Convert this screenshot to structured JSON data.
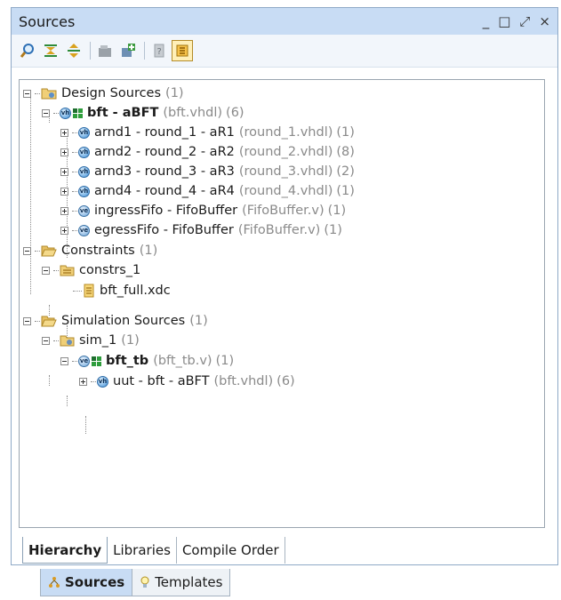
{
  "panel": {
    "title": "Sources",
    "window_controls": [
      "_",
      "□",
      "⤢",
      "×"
    ]
  },
  "toolbar": {
    "buttons": [
      {
        "icon": "search-icon"
      },
      {
        "icon": "collapse-all-icon"
      },
      {
        "icon": "expand-all-icon"
      },
      {
        "icon": "add-sources-icon"
      },
      {
        "icon": "add-module-icon"
      },
      {
        "icon": "properties-icon"
      },
      {
        "icon": "show-hierarchy-icon",
        "active": true
      }
    ]
  },
  "tree": {
    "design_sources": {
      "label": "Design Sources",
      "count": "(1)"
    },
    "bft": {
      "label": "bft - aBFT",
      "file": "(bft.vhdl)",
      "count": "(6)"
    },
    "arnd1": {
      "label": "arnd1 - round_1 - aR1",
      "file": "(round_1.vhdl)",
      "count": "(1)"
    },
    "arnd2": {
      "label": "arnd2 - round_2 - aR2",
      "file": "(round_2.vhdl)",
      "count": "(8)"
    },
    "arnd3": {
      "label": "arnd3 - round_3 - aR3",
      "file": "(round_3.vhdl)",
      "count": "(2)"
    },
    "arnd4": {
      "label": "arnd4 - round_4 - aR4",
      "file": "(round_4.vhdl)",
      "count": "(1)"
    },
    "ingress": {
      "label": "ingressFifo - FifoBuffer",
      "file": "(FifoBuffer.v)",
      "count": "(1)"
    },
    "egress": {
      "label": "egressFifo - FifoBuffer",
      "file": "(FifoBuffer.v)",
      "count": "(1)"
    },
    "constraints": {
      "label": "Constraints",
      "count": "(1)"
    },
    "constrs_1": {
      "label": "constrs_1"
    },
    "bft_full": {
      "label": "bft_full.xdc"
    },
    "sim_sources": {
      "label": "Simulation Sources",
      "count": "(1)"
    },
    "sim_1": {
      "label": "sim_1",
      "count": "(1)"
    },
    "bft_tb": {
      "label": "bft_tb",
      "file": "(bft_tb.v)",
      "count": "(1)"
    },
    "uut": {
      "label": "uut - bft - aBFT",
      "file": "(bft.vhdl)",
      "count": "(6)"
    }
  },
  "view_tabs": [
    "Hierarchy",
    "Libraries",
    "Compile Order"
  ],
  "bottom_tabs": [
    "Sources",
    "Templates"
  ],
  "colors": {
    "titlebar": "#c8dcf4",
    "muted": "#8a8a8a"
  }
}
